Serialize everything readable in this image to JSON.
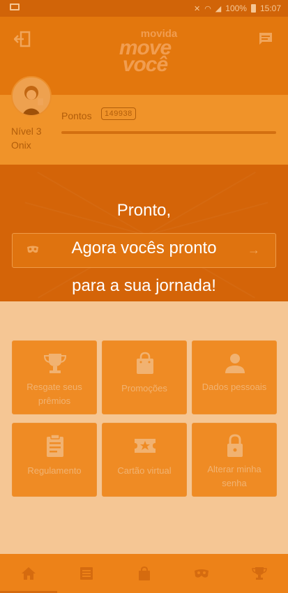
{
  "statusbar": {
    "battery_percent": "100%",
    "time": "15:07"
  },
  "header": {
    "logo_small": "movida",
    "logo_line1": "move",
    "logo_line2": "você",
    "icons": [
      "logout-icon",
      "chat-icon"
    ]
  },
  "profile": {
    "level": "Nível 3",
    "tier": "Onix",
    "points_label": "Pontos",
    "points_value": "149938"
  },
  "cta": {
    "icons": [
      "mask-icon",
      "arrow-right-icon"
    ]
  },
  "menu": {
    "items": [
      {
        "label": "Resgate seus prêmios",
        "icon": "trophy-icon"
      },
      {
        "label": "Promoções",
        "icon": "shopping-bag-icon"
      },
      {
        "label": "Dados pessoais",
        "icon": "person-icon"
      },
      {
        "label": "Regulamento",
        "icon": "clipboard-icon"
      },
      {
        "label": "Cartão virtual",
        "icon": "ticket-star-icon"
      },
      {
        "label": "Alterar minha senha",
        "icon": "lock-icon"
      }
    ]
  },
  "bottom_nav": {
    "items": [
      "home-icon",
      "list-icon",
      "shopping-bag-icon",
      "mask-icon",
      "trophy-icon"
    ]
  },
  "overlay": {
    "line1": "Pronto,",
    "line2": "Agora vocês pronto",
    "line3": "para a sua jornada!"
  },
  "colors": {
    "overlay": "#e87600",
    "header": "#e07818",
    "band": "#c6560f"
  }
}
